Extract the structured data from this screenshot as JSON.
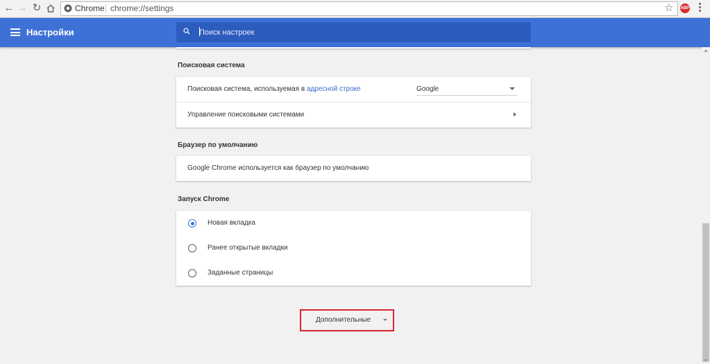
{
  "browser": {
    "site_chip": "Chrome",
    "url": "chrome://settings",
    "extension_label": "ABP"
  },
  "appbar": {
    "title": "Настройки",
    "search_placeholder": "Поиск настроек"
  },
  "search_engine": {
    "section_title": "Поисковая система",
    "engine_row_text": "Поисковая система, используемая в ",
    "engine_row_link": "адресной строке",
    "engine_selected": "Google",
    "manage_label": "Управление поисковыми системами"
  },
  "default_browser": {
    "section_title": "Браузер по умолчанию",
    "status_text": "Google Chrome используется как браузер по умолчанию"
  },
  "startup": {
    "section_title": "Запуск Chrome",
    "options": [
      {
        "label": "Новая вкладка",
        "checked": true
      },
      {
        "label": "Ранее открытые вкладки",
        "checked": false
      },
      {
        "label": "Заданные страницы",
        "checked": false
      }
    ]
  },
  "advanced": {
    "label": "Дополнительные"
  },
  "colors": {
    "accent": "#3e71d6",
    "highlight": "#d8232f"
  }
}
